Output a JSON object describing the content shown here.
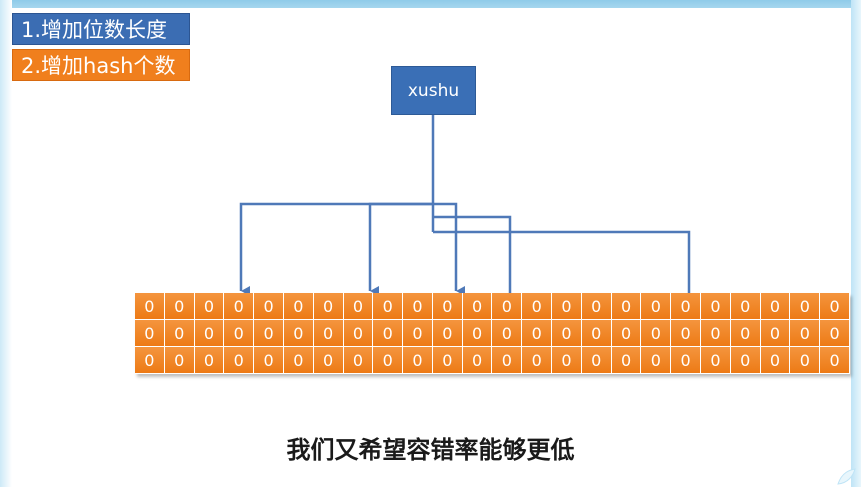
{
  "legend": {
    "item1": "1.增加位数长度",
    "item2": "2.增加hash个数"
  },
  "key_label": "xushu",
  "bit_array": {
    "rows": 3,
    "columns": 24,
    "values": [
      [
        "0",
        "0",
        "0",
        "0",
        "0",
        "0",
        "0",
        "0",
        "0",
        "0",
        "0",
        "0",
        "0",
        "0",
        "0",
        "0",
        "0",
        "0",
        "0",
        "0",
        "0",
        "0",
        "0",
        "0"
      ],
      [
        "0",
        "0",
        "0",
        "0",
        "0",
        "0",
        "0",
        "0",
        "0",
        "0",
        "0",
        "0",
        "0",
        "0",
        "0",
        "0",
        "0",
        "0",
        "0",
        "0",
        "0",
        "0",
        "0",
        "0"
      ],
      [
        "0",
        "0",
        "0",
        "0",
        "0",
        "0",
        "0",
        "0",
        "0",
        "0",
        "0",
        "0",
        "0",
        "0",
        "0",
        "0",
        "0",
        "0",
        "0",
        "0",
        "0",
        "0",
        "0",
        "0"
      ]
    ]
  },
  "caption": "我们又希望容错率能够更低",
  "colors": {
    "blue": "#3b6db3",
    "orange": "#f07f1d",
    "arrow": "#4f79b8"
  }
}
